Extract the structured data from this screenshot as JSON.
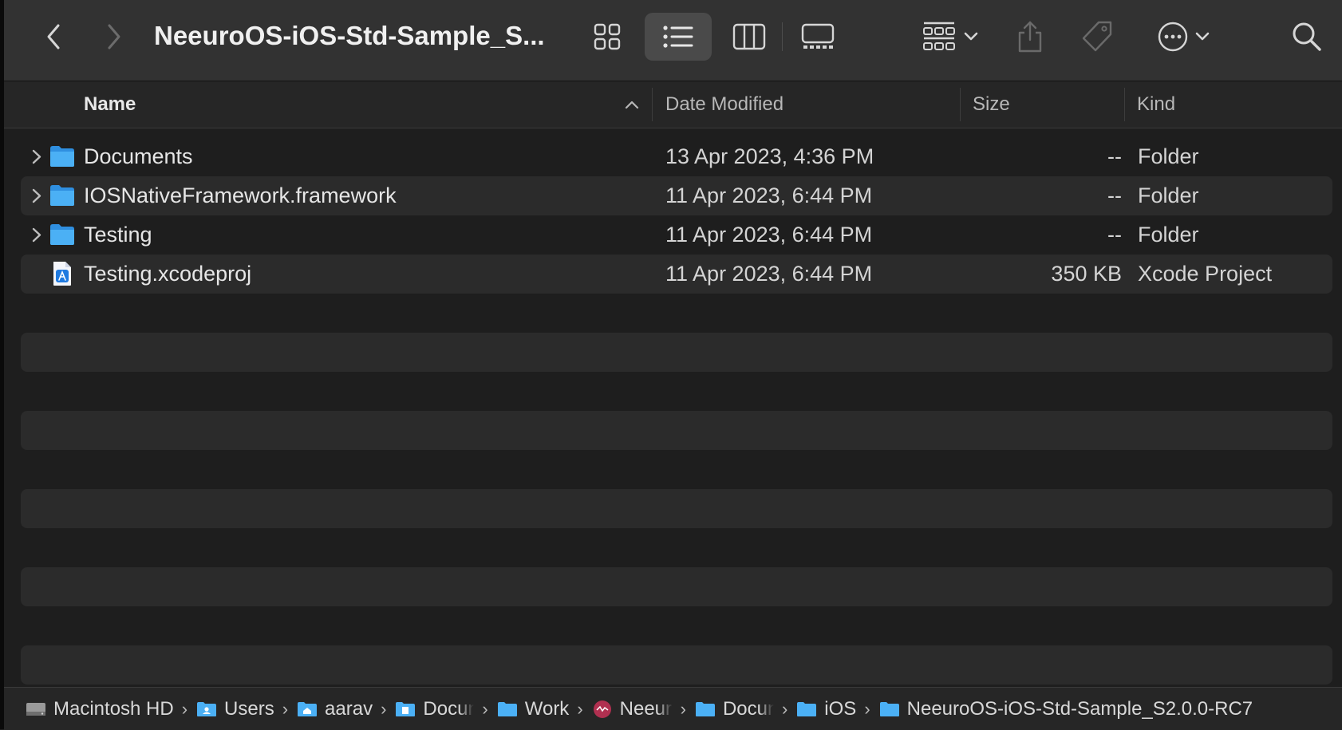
{
  "window": {
    "title": "NeeuroOS-iOS-Std-Sample_S..."
  },
  "toolbar": {
    "back_icon": "chevron-left-icon",
    "forward_icon": "chevron-right-icon",
    "view_modes": [
      "icon-view",
      "list-view",
      "column-view",
      "gallery-view"
    ],
    "active_view": "list-view",
    "group_icon": "group-by-icon",
    "share_icon": "share-icon",
    "tag_icon": "tag-icon",
    "more_icon": "ellipsis-circle-icon",
    "search_icon": "search-icon"
  },
  "columns": {
    "name": "Name",
    "date": "Date Modified",
    "size": "Size",
    "kind": "Kind",
    "sort_indicator": "^"
  },
  "files": [
    {
      "name": "Documents",
      "date": "13 Apr 2023, 4:36 PM",
      "size": "--",
      "kind": "Folder",
      "type": "folder",
      "expandable": true
    },
    {
      "name": "IOSNativeFramework.framework",
      "date": "11 Apr 2023, 6:44 PM",
      "size": "--",
      "kind": "Folder",
      "type": "folder",
      "expandable": true
    },
    {
      "name": "Testing",
      "date": "11 Apr 2023, 6:44 PM",
      "size": "--",
      "kind": "Folder",
      "type": "folder",
      "expandable": true
    },
    {
      "name": "Testing.xcodeproj",
      "date": "11 Apr 2023, 6:44 PM",
      "size": "350 KB",
      "kind": "Xcode Project",
      "type": "xcodeproj",
      "expandable": false
    }
  ],
  "pathbar": {
    "separator": "›",
    "crumbs": [
      "Macintosh HD",
      "Users",
      "aarav",
      "Docun",
      "Work",
      "Neeur",
      "Docun",
      "iOS",
      "NeeuroOS-iOS-Std-Sample_S2.0.0-RC7"
    ]
  },
  "colors": {
    "folder_blue": "#3aa0f0",
    "toolbar_bg": "#323232",
    "alt_row": "#2b2b2b",
    "window_bg": "#1e1e1e"
  }
}
